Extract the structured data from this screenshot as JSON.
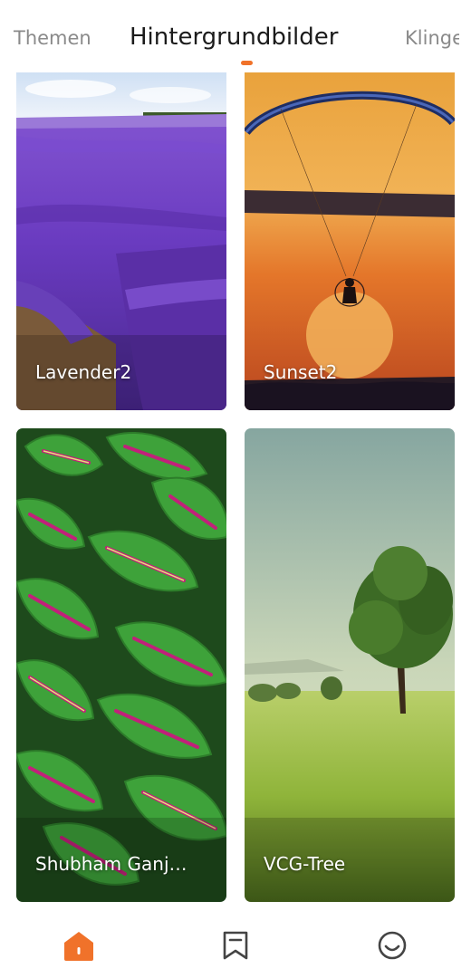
{
  "tabs": {
    "left": "Themen",
    "active": "Hintergrundbilder",
    "right": "Klingeltöne"
  },
  "wallpapers": [
    {
      "label": "Lavender2"
    },
    {
      "label": "Sunset2"
    },
    {
      "label": "Shubham Ganj…"
    },
    {
      "label": "VCG-Tree"
    }
  ],
  "bottom_nav": {
    "items": [
      {
        "icon": "home-icon",
        "active": true
      },
      {
        "icon": "bookmark-icon",
        "active": false
      },
      {
        "icon": "smiley-icon",
        "active": false
      }
    ]
  },
  "colors": {
    "accent": "#f0722a",
    "icon_inactive": "#444444",
    "text_active": "#1b1b1b",
    "text_inactive": "#8a8a8a"
  }
}
